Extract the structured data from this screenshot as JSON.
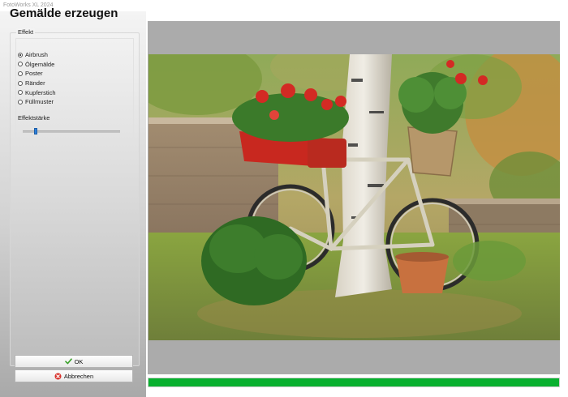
{
  "window": {
    "title": "FotoWorks XL 2024"
  },
  "dialog": {
    "heading": "Gemälde erzeugen",
    "group_label": "Effekt",
    "effects": [
      {
        "label": "Airbrush",
        "selected": true
      },
      {
        "label": "Ölgemälde",
        "selected": false
      },
      {
        "label": "Poster",
        "selected": false
      },
      {
        "label": "Ränder",
        "selected": false
      },
      {
        "label": "Kupferstich",
        "selected": false
      },
      {
        "label": "Füllmuster",
        "selected": false
      }
    ],
    "strength_label": "Effektstärke",
    "strength_value": 0.12,
    "ok_label": "OK",
    "cancel_label": "Abbrechen"
  },
  "progress": {
    "value": 1.0,
    "color": "#08b02f"
  },
  "icons": [
    "checkmark-icon",
    "cancel-icon"
  ]
}
